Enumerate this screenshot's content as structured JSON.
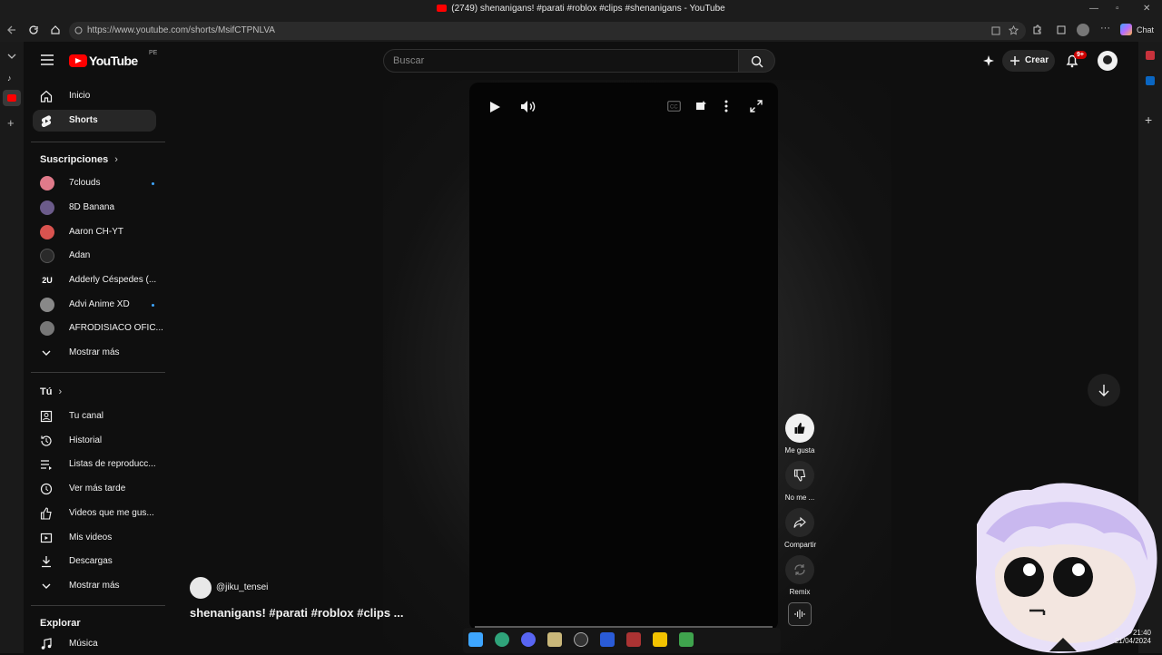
{
  "window": {
    "title": "(2749) shenanigans! #parati #roblox #clips #shenanigans - YouTube"
  },
  "browser": {
    "url": "https://www.youtube.com/shorts/MsifCTPNLVA",
    "copilot_label": "Chat"
  },
  "header": {
    "logo_text": "YouTube",
    "region": "PE",
    "search_placeholder": "Buscar",
    "create_label": "Crear",
    "notifications_badge": "9+"
  },
  "sidebar": {
    "primary": [
      {
        "label": "Inicio",
        "icon": "home-icon"
      },
      {
        "label": "Shorts",
        "icon": "shorts-icon",
        "active": true
      }
    ],
    "subscriptions_heading": "Suscripciones",
    "subscriptions": [
      {
        "label": "7clouds",
        "new": true,
        "color": "#e07a8a"
      },
      {
        "label": "8D Banana",
        "new": false,
        "color": "#6b5b8a"
      },
      {
        "label": "Aaron CH-YT",
        "new": false,
        "color": "#d9534f"
      },
      {
        "label": "Adan",
        "new": false,
        "color": "#222222"
      },
      {
        "label": "Adderly Céspedes (...",
        "new": false,
        "color": "#eeeeee"
      },
      {
        "label": "Advi Anime XD",
        "new": true,
        "color": "#888888"
      },
      {
        "label": "AFRODISIACO OFIC...",
        "new": false,
        "color": "#777777"
      }
    ],
    "show_more_1": "Mostrar más",
    "you_heading": "Tú",
    "you_items": [
      {
        "label": "Tu canal",
        "icon": "user-box-icon"
      },
      {
        "label": "Historial",
        "icon": "history-icon"
      },
      {
        "label": "Listas de reproducc...",
        "icon": "playlist-icon"
      },
      {
        "label": "Ver más tarde",
        "icon": "clock-icon"
      },
      {
        "label": "Videos que me gus...",
        "icon": "thumbs-up-icon"
      },
      {
        "label": "Mis videos",
        "icon": "video-icon"
      },
      {
        "label": "Descargas",
        "icon": "download-icon"
      }
    ],
    "show_more_2": "Mostrar más",
    "explore_heading": "Explorar",
    "explore_items": [
      {
        "label": "Música",
        "icon": "music-icon"
      }
    ]
  },
  "short": {
    "channel": "@jiku_tensei",
    "title": "shenanigans! #parati #roblox #clips ...",
    "actions": {
      "like": "Me gusta",
      "dislike": "No me ...",
      "share": "Compartir",
      "remix": "Remix"
    }
  },
  "system": {
    "time": "21:40",
    "date": "21/04/2024"
  },
  "colors": {
    "brand_red": "#ff0000",
    "background": "#0f0f0f",
    "accent_blue": "#3ea6ff"
  }
}
